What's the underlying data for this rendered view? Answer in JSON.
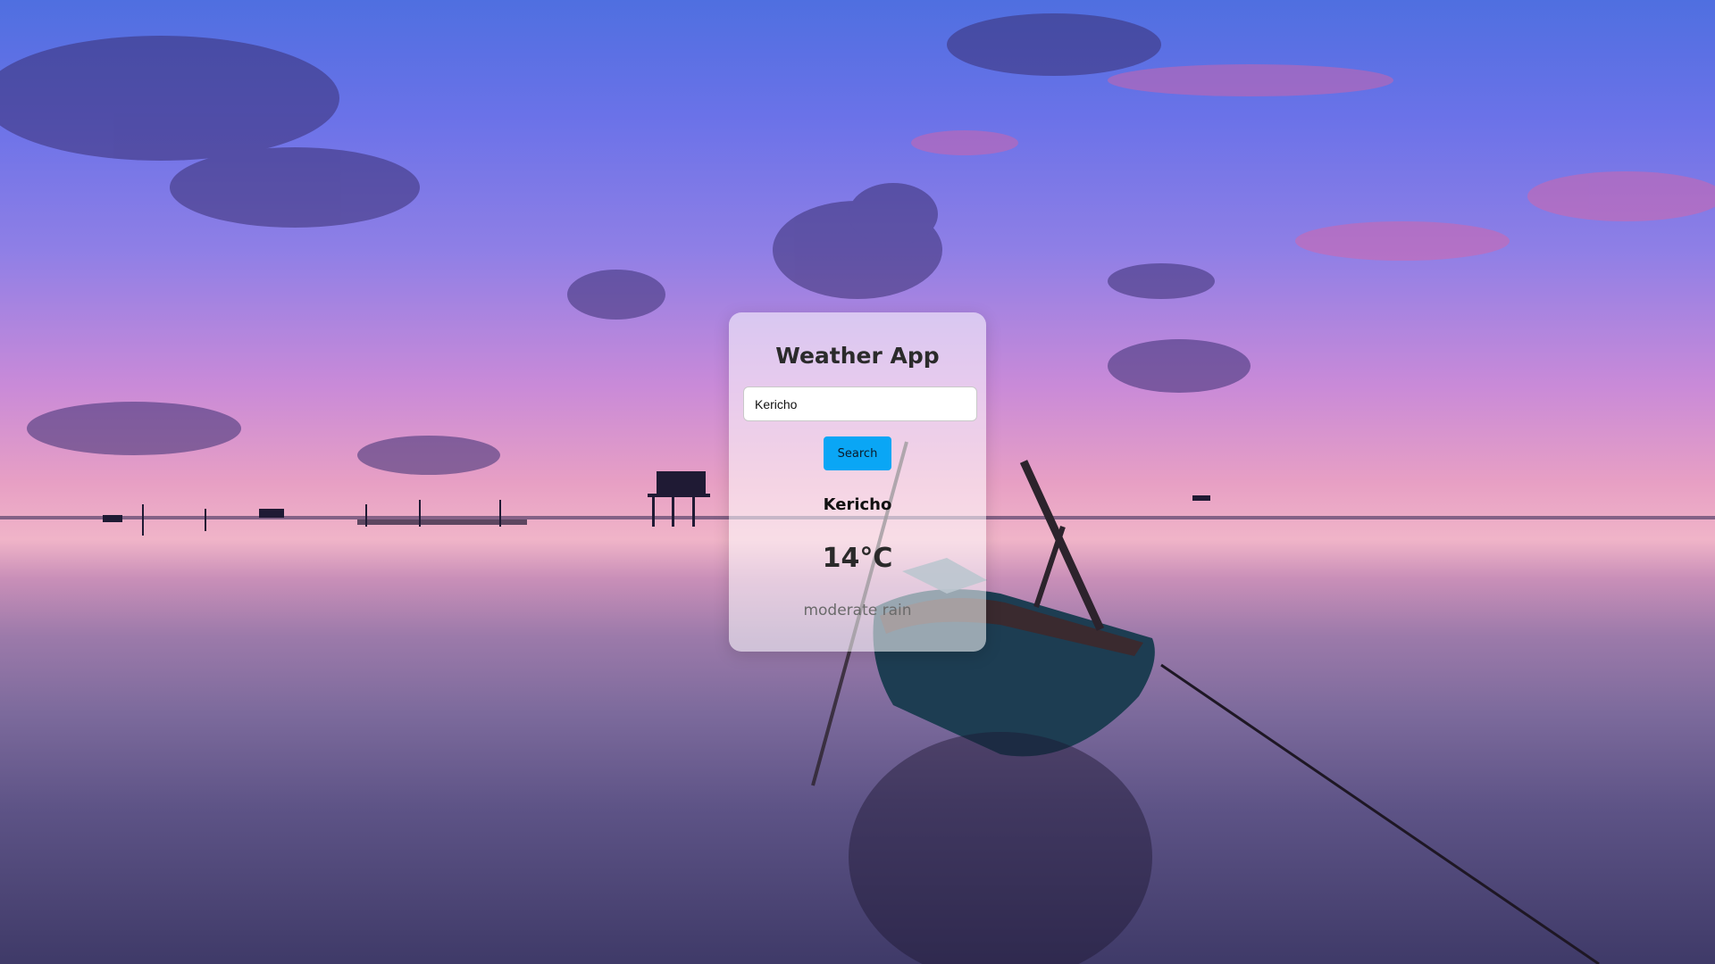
{
  "app": {
    "title": "Weather App"
  },
  "search": {
    "value": "Kericho",
    "placeholder": "",
    "button_label": "Search"
  },
  "weather": {
    "city": "Kericho",
    "temperature": "14°C",
    "description": "moderate rain"
  },
  "colors": {
    "button": "#0aa6f5",
    "card": "rgba(255,255,255,0.55)"
  }
}
